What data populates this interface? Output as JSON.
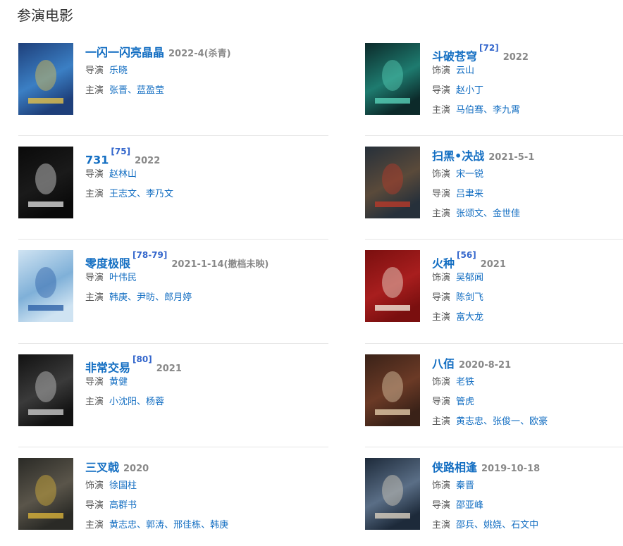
{
  "section": {
    "title": "参演电影"
  },
  "films": [
    {
      "title": "一闪一闪亮晶晶",
      "ref": "",
      "year": "2022-4(杀青)",
      "credits": [
        {
          "role": "导演",
          "names": [
            "乐晓"
          ]
        },
        {
          "role": "主演",
          "names": [
            "张晋",
            "蓝盈莹"
          ]
        }
      ],
      "colors": [
        "#1e3f7a",
        "#3b7fc4",
        "#e2c04b"
      ]
    },
    {
      "title": "斗破苍穹",
      "ref": "[72]",
      "year": "2022",
      "credits": [
        {
          "role": "饰演",
          "names": [
            "云山"
          ]
        },
        {
          "role": "导演",
          "names": [
            "赵小丁"
          ]
        },
        {
          "role": "主演",
          "names": [
            "马伯骞",
            "李九霄"
          ]
        }
      ],
      "colors": [
        "#0c2a2a",
        "#1e7b6f",
        "#58d1b8"
      ]
    },
    {
      "title": "731",
      "ref": "[75]",
      "year": "2022",
      "credits": [
        {
          "role": "导演",
          "names": [
            "赵林山"
          ]
        },
        {
          "role": "主演",
          "names": [
            "王志文",
            "李乃文"
          ]
        }
      ],
      "colors": [
        "#0a0a0a",
        "#1a1a1a",
        "#d8d8d8"
      ]
    },
    {
      "title": "扫黑•决战",
      "ref": "",
      "year": "2021-5-1",
      "credits": [
        {
          "role": "饰演",
          "names": [
            "宋一锐"
          ]
        },
        {
          "role": "导演",
          "names": [
            "吕聿来"
          ]
        },
        {
          "role": "主演",
          "names": [
            "张颂文",
            "金世佳"
          ]
        }
      ],
      "colors": [
        "#26303a",
        "#5a4a3a",
        "#b83a2a"
      ]
    },
    {
      "title": "零度极限",
      "ref": "[78-79]",
      "year": "2021-1-14(撤档未映)",
      "credits": [
        {
          "role": "导演",
          "names": [
            "叶伟民"
          ]
        },
        {
          "role": "主演",
          "names": [
            "韩庚",
            "尹昉",
            "郎月婷"
          ]
        }
      ],
      "colors": [
        "#cfe3f2",
        "#7fb0d8",
        "#2e62a8"
      ]
    },
    {
      "title": "火种",
      "ref": "[56]",
      "year": "2021",
      "credits": [
        {
          "role": "饰演",
          "names": [
            "吴郁闻"
          ]
        },
        {
          "role": "导演",
          "names": [
            "陈剑飞"
          ]
        },
        {
          "role": "主演",
          "names": [
            "富大龙"
          ]
        }
      ],
      "colors": [
        "#7a0f0f",
        "#a81e1e",
        "#f1e6d8"
      ]
    },
    {
      "title": "非常交易",
      "ref": "[80]",
      "year": "2021",
      "credits": [
        {
          "role": "导演",
          "names": [
            "黄健"
          ]
        },
        {
          "role": "主演",
          "names": [
            "小沈阳",
            "杨蓉"
          ]
        }
      ],
      "colors": [
        "#121212",
        "#3a3a3a",
        "#c8c8c8"
      ]
    },
    {
      "title": "八佰",
      "ref": "",
      "year": "2020-8-21",
      "credits": [
        {
          "role": "饰演",
          "names": [
            "老铁"
          ]
        },
        {
          "role": "导演",
          "names": [
            "管虎"
          ]
        },
        {
          "role": "主演",
          "names": [
            "黄志忠",
            "张俊一",
            "欧豪"
          ]
        }
      ],
      "colors": [
        "#3a2218",
        "#6b3a26",
        "#e0c9a8"
      ]
    },
    {
      "title": "三叉戟",
      "ref": "",
      "year": "2020",
      "credits": [
        {
          "role": "饰演",
          "names": [
            "徐国柱"
          ]
        },
        {
          "role": "导演",
          "names": [
            "高群书"
          ]
        },
        {
          "role": "主演",
          "names": [
            "黄志忠",
            "郭涛",
            "邢佳栋",
            "韩庚"
          ]
        }
      ],
      "colors": [
        "#2a2a26",
        "#5a554a",
        "#d8b23a"
      ]
    },
    {
      "title": "侠路相逢",
      "ref": "",
      "year": "2019-10-18",
      "credits": [
        {
          "role": "饰演",
          "names": [
            "秦晋"
          ]
        },
        {
          "role": "导演",
          "names": [
            "邵亚峰"
          ]
        },
        {
          "role": "主演",
          "names": [
            "邵兵",
            "姚娆",
            "石文中"
          ]
        }
      ],
      "colors": [
        "#1d2a3a",
        "#5a6e86",
        "#d9d0bf"
      ]
    }
  ]
}
